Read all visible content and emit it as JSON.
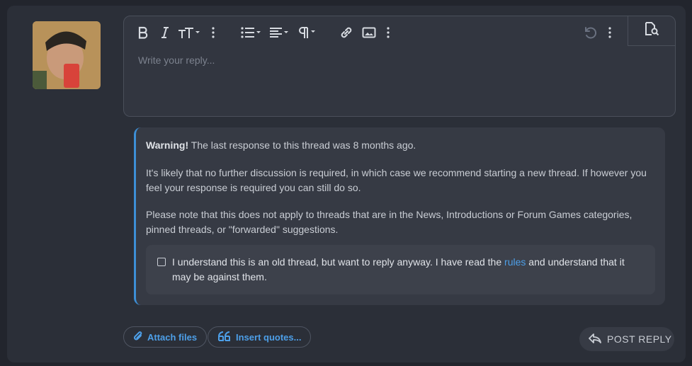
{
  "editor": {
    "placeholder": "Write your reply...",
    "toolbar": {
      "buttons": [
        "bold-icon",
        "italic-icon",
        "text-size-icon",
        "more-vertical-icon",
        "list-icon",
        "align-icon",
        "paragraph-icon",
        "link-icon",
        "image-icon",
        "more-vertical-icon",
        "undo-icon",
        "more-vertical-icon",
        "preview-icon"
      ]
    }
  },
  "warning": {
    "title": "Warning!",
    "line1": "The last response to this thread was 8 months ago.",
    "line2": "It's likely that no further discussion is required, in which case we recommend starting a new thread. If however you feel your response is required you can still do so.",
    "line3": "Please note that this does not apply to threads that are in the News, Introductions or Forum Games categories, pinned threads, or \"forwarded\" suggestions.",
    "ack_before": "I understand this is an old thread, but want to reply anyway. I have read the",
    "ack_link": "rules",
    "ack_after": "and understand that it may be against them."
  },
  "actions": {
    "attach_label": "Attach files",
    "quotes_label": "Insert quotes...",
    "post_label": "POST REPLY"
  },
  "colors": {
    "accent": "#4d9fe8",
    "warning_border": "#3d8fd6",
    "panel": "#2b2f38"
  }
}
